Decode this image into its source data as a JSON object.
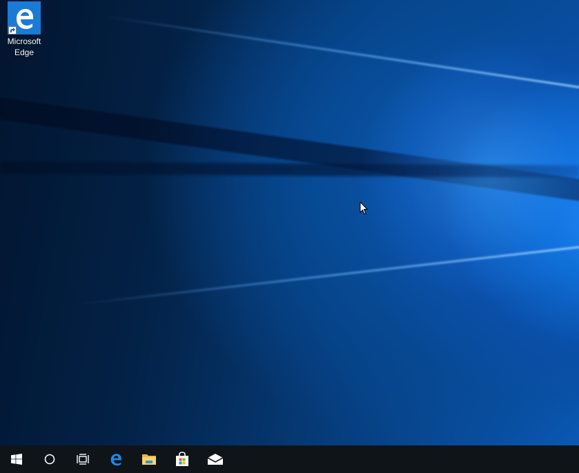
{
  "desktop": {
    "icons": [
      {
        "label_line1": "Microsoft",
        "label_line2": "Edge",
        "icon": "edge-icon"
      }
    ]
  },
  "taskbar": {
    "buttons": [
      {
        "name": "start-button",
        "icon": "windows-logo-icon"
      },
      {
        "name": "cortana-search-button",
        "icon": "circle-search-icon"
      },
      {
        "name": "task-view-button",
        "icon": "task-view-icon"
      },
      {
        "name": "edge-taskbar-button",
        "icon": "edge-icon"
      },
      {
        "name": "file-explorer-button",
        "icon": "folder-icon"
      },
      {
        "name": "store-button",
        "icon": "store-bag-icon"
      },
      {
        "name": "mail-button",
        "icon": "envelope-icon"
      }
    ]
  },
  "colors": {
    "taskbar_bg": "#0f1419",
    "edge_blue": "#1b7ad6",
    "wallpaper_dark": "#02152f",
    "wallpaper_light": "#1f8cff"
  }
}
